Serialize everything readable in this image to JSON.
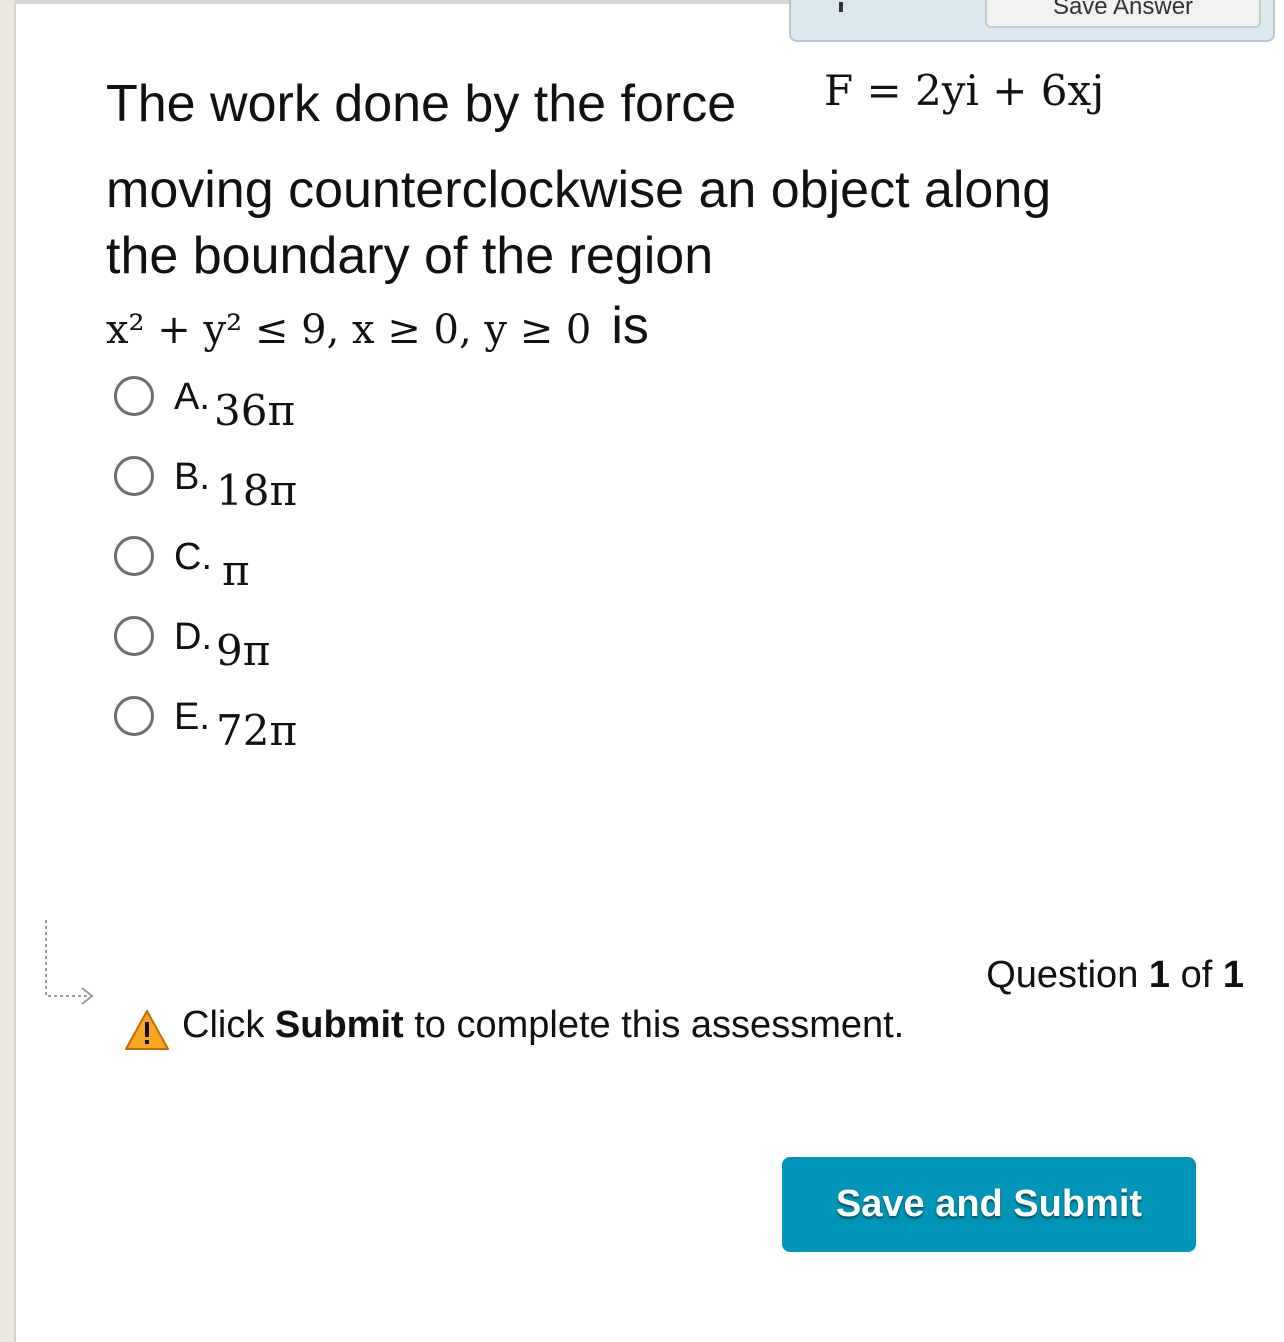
{
  "top_bar": {
    "save_answer_label": "Save Answer"
  },
  "question": {
    "line1_text": "The work done by the force",
    "force": "F = 2yi + 6xj",
    "line2_text": "moving counterclockwise an object along",
    "line3_text": "the boundary of the region",
    "region": "x² + y² ≤ 9,  x ≥ 0,  y ≥ 0",
    "line4_tail": "is"
  },
  "choices": [
    {
      "letter": "A.",
      "value": "36π"
    },
    {
      "letter": "B.",
      "value": "18π"
    },
    {
      "letter": "C.",
      "value": "π"
    },
    {
      "letter": "D.",
      "value": "9π"
    },
    {
      "letter": "E.",
      "value": "72π"
    }
  ],
  "footer": {
    "progress_prefix": "Question",
    "current": "1",
    "progress_of": "of",
    "total": "1",
    "warning_pre": "Click",
    "warning_bold": "Submit",
    "warning_post": "to complete this assessment.",
    "submit_label": "Save and Submit"
  },
  "colors": {
    "submit_button": "#0095b6",
    "save_bar": "#dbe8ee",
    "warning_icon": "#f5a623"
  },
  "icons": [
    "warning-icon",
    "next-arrow-icon",
    "radio-icon"
  ]
}
